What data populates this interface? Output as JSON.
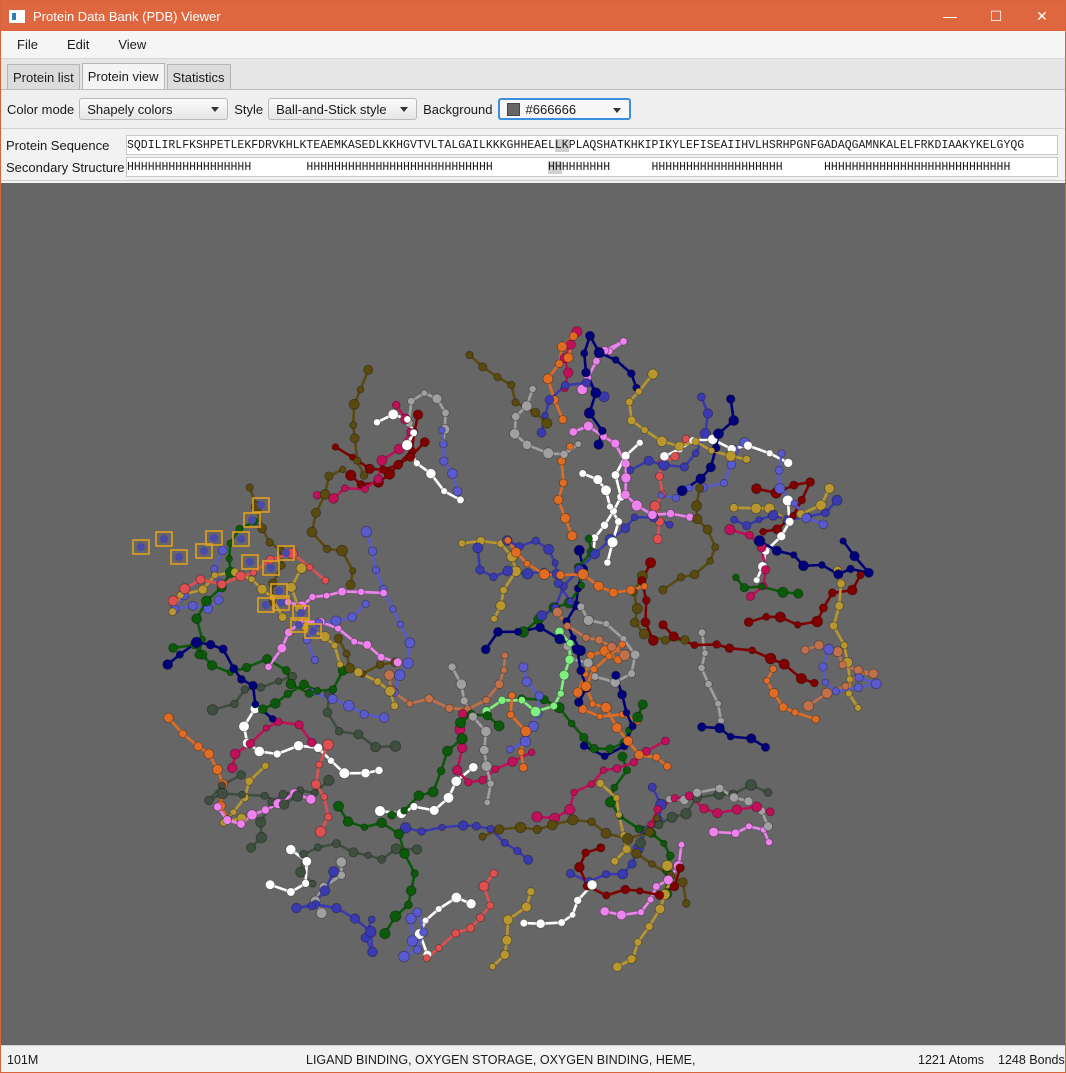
{
  "window": {
    "title": "Protein Data Bank (PDB) Viewer",
    "minimize": "—",
    "maximize": "☐",
    "close": "✕"
  },
  "menu": [
    "File",
    "Edit",
    "View"
  ],
  "tabs": [
    "Protein list",
    "Protein view",
    "Statistics"
  ],
  "active_tab": "Protein view",
  "toolbar": {
    "color_mode_label": "Color mode",
    "color_mode_value": "Shapely colors",
    "style_label": "Style",
    "style_value": "Ball-and-Stick style",
    "background_label": "Background",
    "background_value": "#666666",
    "background_color": "#666666"
  },
  "sequence": {
    "protein_label": "Protein Sequence",
    "protein_before": "SQDILIRLFKSHPETLEKFDRVKHLKTEAEMKASEDLKKHGVTVLTALGAILKKKGHHEAEL",
    "protein_highlight": "LK",
    "protein_after": "PLAQSHATKHKIPIKYLEFISEAIIHVLHSRHPGNFGADAQGAMNKALELFRKDIAAKYKELGYQG",
    "structure_label": "Secondary Structure",
    "structure_before": "HHHHHHHHHHHHHHHHHH        HHHHHHHHHHHHHHHHHHHHHHHHHHH        ",
    "structure_highlight": "HH",
    "structure_after": "HHHHHHH      HHHHHHHHHHHHHHHHHHH      HHHHHHHHHHHHHHHHHHHHHHHHHHH"
  },
  "status": {
    "pdb_id": "101M",
    "keywords": "LIGAND BINDING, OXYGEN STORAGE, OXYGEN BINDING, HEME,",
    "atoms": "1221 Atoms",
    "bonds": "1248 Bonds"
  },
  "palette": [
    "#5a5acf",
    "#3a3ab0",
    "#800000",
    "#0a5a0a",
    "#3f4f3f",
    "#e05050",
    "#ee82ee",
    "#c0105a",
    "#80f080",
    "#e06c24",
    "#ffffff",
    "#b89630",
    "#a0a0a0",
    "#00007a",
    "#5a4a10",
    "#c0704a"
  ]
}
